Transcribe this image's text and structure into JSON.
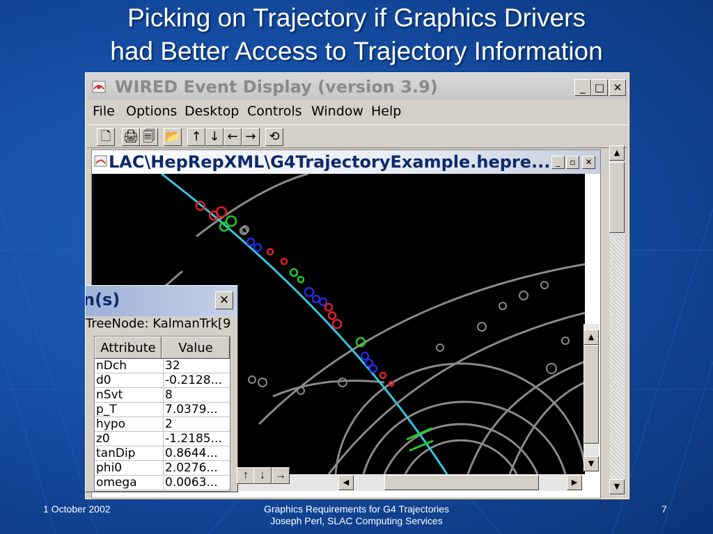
{
  "slide": {
    "title_line1": "Picking on Trajectory if Graphics Drivers",
    "title_line2": "had Better Access to Trajectory Information",
    "footer_date": "1 October 2002",
    "footer_line1": "Graphics Requirements for G4 Trajectories",
    "footer_line2": "Joseph Perl, SLAC Computing Services",
    "page_number": "7"
  },
  "app": {
    "title": "WIRED Event Display (version 3.9)",
    "minimize": "_",
    "maximize": "□",
    "close": "✕",
    "menu": [
      "File",
      "Options",
      "Desktop",
      "Controls",
      "Window",
      "Help"
    ],
    "toolbar": [
      "🗋",
      "🖨",
      "🗐",
      "📂",
      "↑",
      "↓",
      "←",
      "→",
      "⟲"
    ]
  },
  "inner_window": {
    "title": "LAC\\HepRepXML\\G4TrajectoryExample.hepre...",
    "minimize": "_",
    "restore": "▫",
    "close": "✕"
  },
  "popup": {
    "title": "n(s)",
    "close": "✕",
    "node": "TreeNode: KalmanTrk[9",
    "headers": [
      "Attribute",
      "Value"
    ],
    "rows": [
      {
        "attr": "nDch",
        "value": "32"
      },
      {
        "attr": "d0",
        "value": "-0.2128..."
      },
      {
        "attr": "nSvt",
        "value": "8"
      },
      {
        "attr": "p_T",
        "value": "7.0379..."
      },
      {
        "attr": "hypo",
        "value": "2"
      },
      {
        "attr": "z0",
        "value": "-1.2185..."
      },
      {
        "attr": "tanDip",
        "value": "0.8644..."
      },
      {
        "attr": "phi0",
        "value": "2.0276..."
      },
      {
        "attr": "omega",
        "value": "0.0063..."
      }
    ],
    "nav": [
      "↑",
      "↓",
      "→"
    ]
  },
  "colors": {
    "track": "#35c8e0",
    "hit_red": "#e0202a",
    "hit_green": "#22d022",
    "hit_blue": "#2a2ae0",
    "grey_track": "#8a8a8a"
  }
}
